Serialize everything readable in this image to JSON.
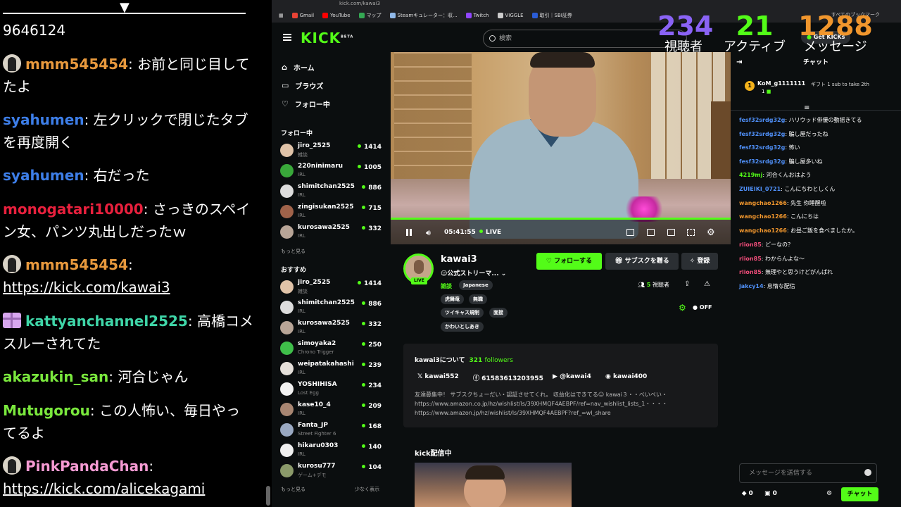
{
  "overlay_chat": {
    "top_text": "9646124",
    "messages": [
      {
        "user": "mmm545454",
        "color": "#e8993d",
        "text": ": お前と同じ目して",
        "text2": "たよ",
        "icon": "avatar"
      },
      {
        "user": "syahumen",
        "color": "#3d7ee8",
        "text": ": 左クリックで閉じたタブ",
        "text2": "を再度開く"
      },
      {
        "user": "syahumen",
        "color": "#3d7ee8",
        "text": ": 右だった"
      },
      {
        "user": "monogatari10000",
        "color": "#e8203d",
        "text": ": さっきのスペイ",
        "text2": "ン女、パンツ丸出しだったｗ"
      },
      {
        "user": "mmm545454",
        "color": "#e8993d",
        "text": ":",
        "link": "https://kick.com/kawai3",
        "icon": "avatar"
      },
      {
        "user": "kattyanchannel2525",
        "color": "#3fd6a8",
        "text": ": 高橋コメ",
        "text2": "スルーされてた",
        "icon": "gift"
      },
      {
        "user": "akazukin_san",
        "color": "#7ae83d",
        "text": ": 河合じゃん"
      },
      {
        "user": "Mutugorou",
        "color": "#7ae83d",
        "text": ": この人怖い、毎日やっ",
        "text2": "てるよ"
      },
      {
        "user": "PinkPandaChan",
        "color": "#f59ad2",
        "text": ":",
        "link": "https://kick.com/alicekagami",
        "icon": "avatar"
      }
    ]
  },
  "browser": {
    "url": "kick.com/kawai3",
    "bookmarks": [
      {
        "label": "Gmail",
        "color": "#ea4335"
      },
      {
        "label": "YouTube",
        "color": "#ff0000"
      },
      {
        "label": "マップ",
        "color": "#34a853"
      },
      {
        "label": "Steamキュレーター：収...",
        "color": "#8fb8e8"
      },
      {
        "label": "Twitch",
        "color": "#9146ff"
      },
      {
        "label": "VIGGLE",
        "color": "#cccccc"
      },
      {
        "label": "取引｜SBI証券",
        "color": "#2a5cd6"
      }
    ],
    "bookmarks_right": "すべてのブックマーク"
  },
  "stats": {
    "viewers": {
      "value": "234",
      "label": "視聴者",
      "color": "#8a63f5"
    },
    "active": {
      "value": "21",
      "label": "アクティブ",
      "color": "#53fc18"
    },
    "messages": {
      "value": "1288",
      "label": "メッセージ",
      "color": "#f0962d"
    }
  },
  "header": {
    "logo": "KICK",
    "logo_sup": "BETA",
    "search_placeholder": "検索",
    "get_kicks": "Get KICKs"
  },
  "sidebar": {
    "nav": [
      {
        "label": "ホーム"
      },
      {
        "label": "ブラウズ"
      },
      {
        "label": "フォロー中"
      }
    ],
    "following_title": "フォロー中",
    "following": [
      {
        "name": "jiro_2525",
        "cat": "雑談",
        "viewers": "1414"
      },
      {
        "name": "220ninimaru",
        "cat": "IRL",
        "viewers": "1005"
      },
      {
        "name": "shimitchan2525",
        "cat": "IRL",
        "viewers": "886"
      },
      {
        "name": "zingisukan2525",
        "cat": "IRL",
        "viewers": "715"
      },
      {
        "name": "kurosawa2525",
        "cat": "IRL",
        "viewers": "332"
      }
    ],
    "show_more": "もっと見る",
    "recommended_title": "おすすめ",
    "recommended": [
      {
        "name": "jiro_2525",
        "cat": "雑談",
        "viewers": "1414"
      },
      {
        "name": "shimitchan2525",
        "cat": "IRL",
        "viewers": "886"
      },
      {
        "name": "kurosawa2525",
        "cat": "IRL",
        "viewers": "332"
      },
      {
        "name": "simoyaka2",
        "cat": "Chrono Trigger",
        "viewers": "250"
      },
      {
        "name": "weipatakahashi",
        "cat": "IRL",
        "viewers": "239"
      },
      {
        "name": "YOSHIHISA",
        "cat": "Lost Egg",
        "viewers": "234"
      },
      {
        "name": "kase10_4",
        "cat": "IRL",
        "viewers": "209"
      },
      {
        "name": "Fanta_JP",
        "cat": "Street Fighter 6",
        "viewers": "168"
      },
      {
        "name": "hikaru0303",
        "cat": "IRL",
        "viewers": "140"
      },
      {
        "name": "kurosu777",
        "cat": "ゲーム+デモ",
        "viewers": "104"
      }
    ],
    "show_more_2": "もっと見る",
    "show_less": "少なく表示"
  },
  "player": {
    "time": "05:41:55",
    "live": "LIVE"
  },
  "stream": {
    "name": "kawai3",
    "title": "😐公式ストリーマ...",
    "category": "雑談",
    "language": "Japanese",
    "tags": [
      "虎舞竜",
      "無職",
      "ツイキャス規制",
      "面接",
      "かわいとしあき"
    ],
    "live_badge": "LIVE",
    "follow": "フォローする",
    "gift_sub": "サブスクを贈る",
    "subscribe": "登録",
    "viewer_count": "5",
    "viewer_label": "視聴者",
    "toggle": "OFF"
  },
  "about": {
    "title": "kawai3について",
    "followers": "321",
    "followers_label": "followers",
    "socials": [
      {
        "label": "kawai552"
      },
      {
        "label": "61583613203955"
      },
      {
        "label": "@kawai4"
      },
      {
        "label": "kawai400"
      }
    ],
    "desc": "友達募集中！ サブスクちょーだい・認証させてくれ。 収益化はできてる😑 kawai３・・べいべい・https://www.amazon.co.jp/hz/wishlist/ls/39XHMQF4AEBPF/ref=nav_wishlist_lists_1・・・・https://www.amazon.jp/hz/wishlist/ls/39XHMQF4AEBPF?ref_=wl_share"
  },
  "kick_live": "kick配信中",
  "chat": {
    "title": "チャット",
    "pinned_user": "KoM_g1111111",
    "pinned_count": "1",
    "pinned_gift": "ギフト 1 sub to take 2th",
    "messages": [
      {
        "user": "fesf32srdg32g",
        "color": "#4f8ff7",
        "text": ": ハリウッド俳優の動揺きてる"
      },
      {
        "user": "fesf32srdg32g",
        "color": "#4f8ff7",
        "text": ": 騙し屋だったね"
      },
      {
        "user": "fesf32srdg32g",
        "color": "#4f8ff7",
        "text": ": 怖い"
      },
      {
        "user": "fesf32srdg32g",
        "color": "#4f8ff7",
        "text": ": 騙し屋多いね"
      },
      {
        "user": "4219mj",
        "color": "#53fc18",
        "text": ": 河合くんおはよう"
      },
      {
        "user": "ZUIEIKI_0721",
        "color": "#4f8ff7",
        "text": ": こんにちわとしくん"
      },
      {
        "user": "wangchao1266",
        "color": "#f0962d",
        "text": ": 先生 你睡醒啦"
      },
      {
        "user": "wangchao1266",
        "color": "#f0962d",
        "text": ": こんにちは"
      },
      {
        "user": "wangchao1266",
        "color": "#f0962d",
        "text": ": お昼ご飯を食べましたか。"
      },
      {
        "user": "rlion85",
        "color": "#f04d7a",
        "text": ": どーなの？"
      },
      {
        "user": "rlion85",
        "color": "#f04d7a",
        "text": ": わからんよな～"
      },
      {
        "user": "rlion85",
        "color": "#f04d7a",
        "text": ": 無理やと思うけどがんばれ"
      },
      {
        "user": "jakcy14",
        "color": "#4f8ff7",
        "text": ": 怠惰な配信"
      }
    ],
    "input_placeholder": "メッセージを送信する",
    "kicks_count": "0",
    "gifts_count": "0",
    "send": "チャット"
  }
}
